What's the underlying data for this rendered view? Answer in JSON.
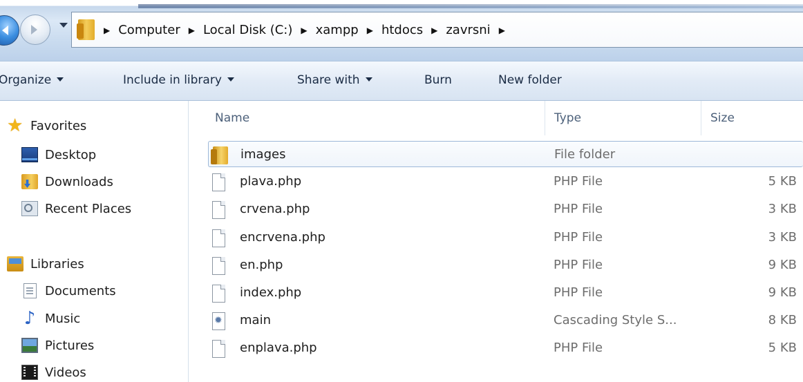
{
  "address_bar": {
    "breadcrumbs": [
      "Computer",
      "Local Disk (C:)",
      "xampp",
      "htdocs",
      "zavrsni"
    ]
  },
  "toolbar": {
    "organize": "Organize",
    "include_in_library": "Include in library",
    "share_with": "Share with",
    "burn": "Burn",
    "new_folder": "New folder"
  },
  "nav": {
    "favorites": {
      "label": "Favorites",
      "items": [
        "Desktop",
        "Downloads",
        "Recent Places"
      ]
    },
    "libraries": {
      "label": "Libraries",
      "items": [
        "Documents",
        "Music",
        "Pictures",
        "Videos"
      ]
    }
  },
  "columns": {
    "name": "Name",
    "type": "Type",
    "size": "Size"
  },
  "files": [
    {
      "name": "images",
      "type": "File folder",
      "size": "",
      "icon": "folder-icon"
    },
    {
      "name": "plava.php",
      "type": "PHP File",
      "size": "5 KB",
      "icon": "php-file-icon"
    },
    {
      "name": "crvena.php",
      "type": "PHP File",
      "size": "3 KB",
      "icon": "php-file-icon"
    },
    {
      "name": "encrvena.php",
      "type": "PHP File",
      "size": "3 KB",
      "icon": "php-file-icon"
    },
    {
      "name": "en.php",
      "type": "PHP File",
      "size": "9 KB",
      "icon": "php-file-icon"
    },
    {
      "name": "index.php",
      "type": "PHP File",
      "size": "9 KB",
      "icon": "php-file-icon"
    },
    {
      "name": "main",
      "type": "Cascading Style S...",
      "size": "8 KB",
      "icon": "css-file-icon"
    },
    {
      "name": "enplava.php",
      "type": "PHP File",
      "size": "5 KB",
      "icon": "php-file-icon"
    }
  ]
}
